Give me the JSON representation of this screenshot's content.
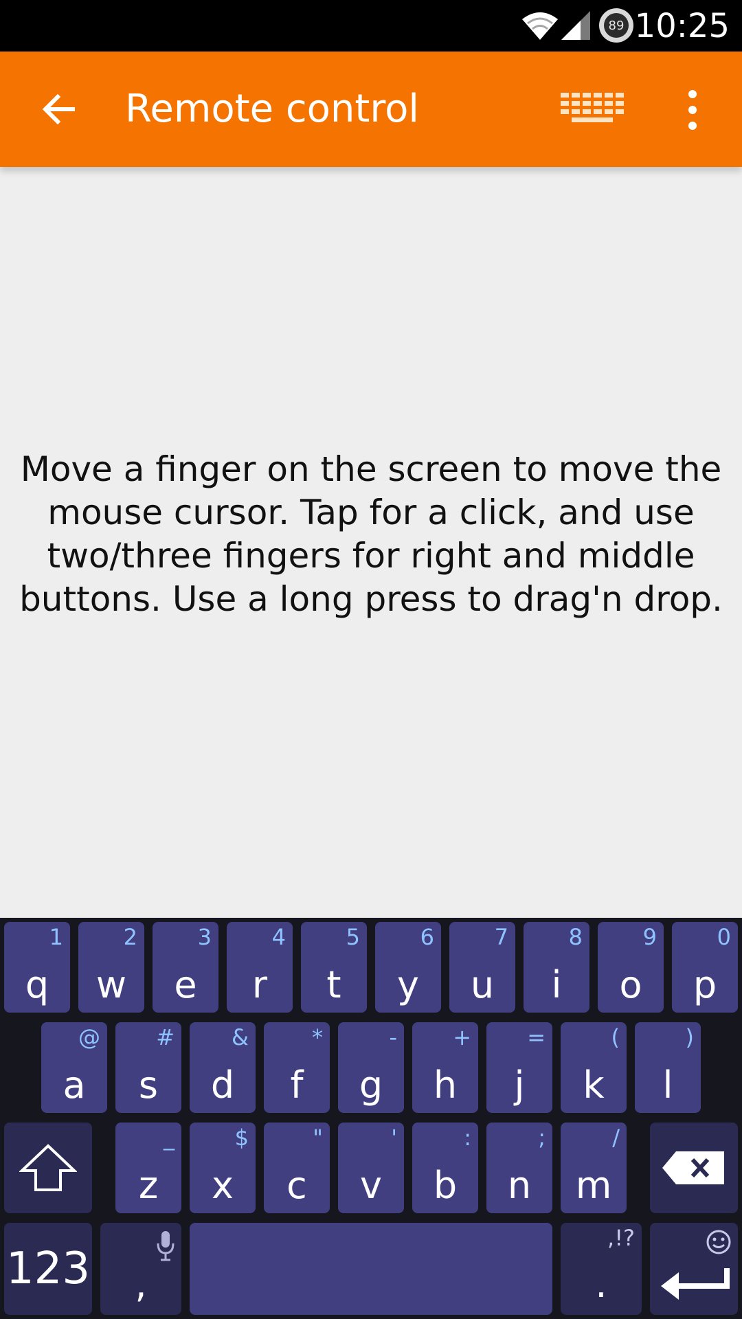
{
  "status_bar": {
    "time": "10:25",
    "battery_level": "89",
    "icons": [
      "wifi-icon",
      "signal-icon",
      "battery-icon"
    ]
  },
  "app_bar": {
    "title": "Remote control",
    "background_color": "#f57300",
    "icons": [
      "back-arrow-icon",
      "keyboard-icon",
      "more-vert-icon"
    ]
  },
  "content": {
    "hint_text": "Move a finger on the screen to move the mouse cursor. Tap for a click, and use two/three fingers for right and middle buttons. Use a long press to drag'n drop."
  },
  "keyboard": {
    "key_color": "#413f7f",
    "hint_color": "#8fc3ff",
    "row1": [
      {
        "label": "q",
        "hint": "1"
      },
      {
        "label": "w",
        "hint": "2"
      },
      {
        "label": "e",
        "hint": "3"
      },
      {
        "label": "r",
        "hint": "4"
      },
      {
        "label": "t",
        "hint": "5"
      },
      {
        "label": "y",
        "hint": "6"
      },
      {
        "label": "u",
        "hint": "7"
      },
      {
        "label": "i",
        "hint": "8"
      },
      {
        "label": "o",
        "hint": "9"
      },
      {
        "label": "p",
        "hint": "0"
      }
    ],
    "row2": [
      {
        "label": "a",
        "hint": "@"
      },
      {
        "label": "s",
        "hint": "#"
      },
      {
        "label": "d",
        "hint": "&"
      },
      {
        "label": "f",
        "hint": "*"
      },
      {
        "label": "g",
        "hint": "-"
      },
      {
        "label": "h",
        "hint": "+"
      },
      {
        "label": "j",
        "hint": "="
      },
      {
        "label": "k",
        "hint": "("
      },
      {
        "label": "l",
        "hint": ")"
      }
    ],
    "row3": [
      {
        "label": "z",
        "hint": "_"
      },
      {
        "label": "x",
        "hint": "$"
      },
      {
        "label": "c",
        "hint": "\""
      },
      {
        "label": "v",
        "hint": "'"
      },
      {
        "label": "b",
        "hint": ":"
      },
      {
        "label": "n",
        "hint": ";"
      },
      {
        "label": "m",
        "hint": "/"
      }
    ],
    "numbers_label": "123",
    "comma_label": ",",
    "period_label": ".",
    "period_hint": ",!?",
    "special_icons": [
      "shift-icon",
      "backspace-icon",
      "mic-icon",
      "smiley-icon",
      "enter-icon"
    ]
  }
}
